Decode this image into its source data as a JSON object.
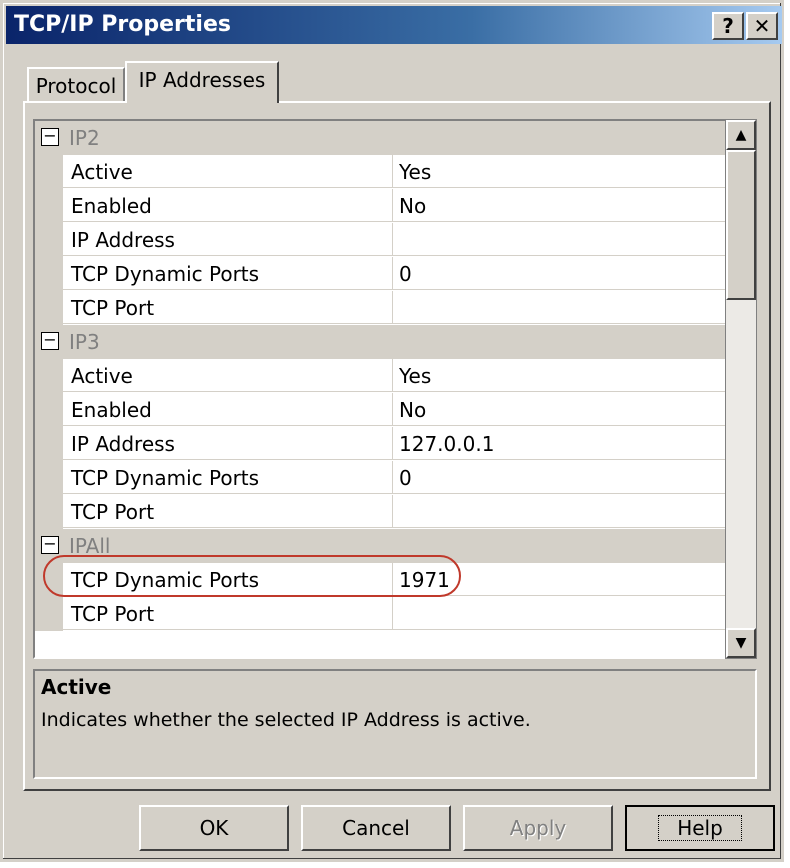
{
  "window": {
    "title": "TCP/IP Properties",
    "help_glyph": "?",
    "close_glyph": "✕"
  },
  "tabs": [
    {
      "label": "Protocol"
    },
    {
      "label": "IP Addresses"
    }
  ],
  "groups": [
    {
      "label": "IP2",
      "toggle": "⊟",
      "rows": [
        {
          "name": "Active",
          "value": "Yes"
        },
        {
          "name": "Enabled",
          "value": "No"
        },
        {
          "name": "IP Address",
          "value": ""
        },
        {
          "name": "TCP Dynamic Ports",
          "value": "0"
        },
        {
          "name": "TCP Port",
          "value": ""
        }
      ]
    },
    {
      "label": "IP3",
      "toggle": "⊟",
      "rows": [
        {
          "name": "Active",
          "value": "Yes"
        },
        {
          "name": "Enabled",
          "value": "No"
        },
        {
          "name": "IP Address",
          "value": "127.0.0.1"
        },
        {
          "name": "TCP Dynamic Ports",
          "value": "0"
        },
        {
          "name": "TCP Port",
          "value": ""
        }
      ]
    },
    {
      "label": "IPAll",
      "toggle": "⊟",
      "rows": [
        {
          "name": "TCP Dynamic Ports",
          "value": "1971"
        },
        {
          "name": "TCP Port",
          "value": ""
        }
      ]
    }
  ],
  "scrollbar": {
    "up_glyph": "▲",
    "down_glyph": "▼"
  },
  "description": {
    "title": "Active",
    "text": "Indicates whether the selected IP Address is active."
  },
  "buttons": {
    "ok": "OK",
    "cancel": "Cancel",
    "apply": "Apply",
    "help": "Help"
  },
  "colors": {
    "title_start": "#0a246a",
    "highlight": "#c0392b",
    "face": "#d4d0c8"
  }
}
